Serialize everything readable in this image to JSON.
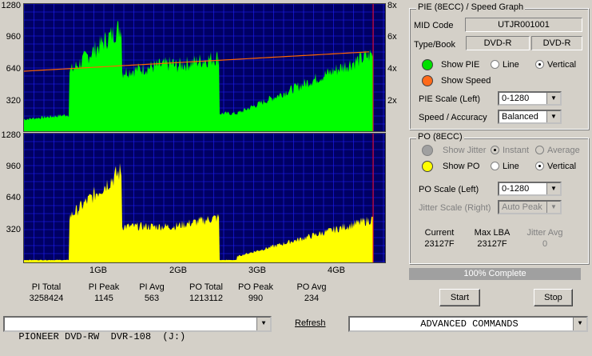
{
  "pie_chart": {
    "left_axis": [
      "1280",
      "960",
      "640",
      "320"
    ],
    "right_axis": [
      "8x",
      "6x",
      "4x",
      "2x"
    ],
    "colors": {
      "fill": "#00ff00",
      "speed": "#ff6600",
      "bg": "#000064",
      "grid": "#2020ff",
      "marker": "#ff0000"
    }
  },
  "po_chart": {
    "left_axis": [
      "1280",
      "960",
      "640",
      "320"
    ],
    "colors": {
      "fill": "#ffff00",
      "bg": "#000064",
      "grid": "#2020ff",
      "marker": "#ff0000"
    }
  },
  "x_axis": [
    "1GB",
    "2GB",
    "3GB",
    "4GB"
  ],
  "stats": [
    {
      "label": "PI Total",
      "value": "3258424"
    },
    {
      "label": "PI Peak",
      "value": "1145"
    },
    {
      "label": "PI Avg",
      "value": "563"
    },
    {
      "label": "PO Total",
      "value": "1213112"
    },
    {
      "label": "PO Peak",
      "value": "990"
    },
    {
      "label": "PO Avg",
      "value": "234"
    }
  ],
  "pie_panel": {
    "title": "PIE (8ECC) / Speed Graph",
    "mid_label": "MID Code",
    "mid_value": "UTJR001001",
    "type_label": "Type/Book",
    "type_value": "DVD-R",
    "book_value": "DVD-R",
    "show_pie": "Show PIE",
    "line": "Line",
    "vertical": "Vertical",
    "show_speed": "Show Speed",
    "scale_label": "PIE Scale (Left)",
    "scale_value": "0-1280",
    "accuracy_label": "Speed / Accuracy",
    "accuracy_value": "Balanced"
  },
  "po_panel": {
    "title": "PO (8ECC)",
    "show_jitter": "Show Jitter",
    "instant": "Instant",
    "average": "Average",
    "show_po": "Show PO",
    "line": "Line",
    "vertical": "Vertical",
    "scale_label": "PO Scale (Left)",
    "scale_value": "0-1280",
    "jitter_label": "Jitter Scale (Right)",
    "jitter_value": "Auto Peak",
    "current_label": "Current",
    "current_value": "23127F",
    "maxlba_label": "Max LBA",
    "maxlba_value": "23127F",
    "jitter_avg_label": "Jitter Avg",
    "jitter_avg_value": "0"
  },
  "progress": {
    "text": "100% Complete",
    "value": 1.0
  },
  "buttons": {
    "start": "Start",
    "stop": "Stop",
    "refresh": "Refresh"
  },
  "drive": {
    "value": "PIONEER DVD-RW  DVR-108  (J:)"
  },
  "commands": {
    "value": "ADVANCED COMMANDS"
  }
}
